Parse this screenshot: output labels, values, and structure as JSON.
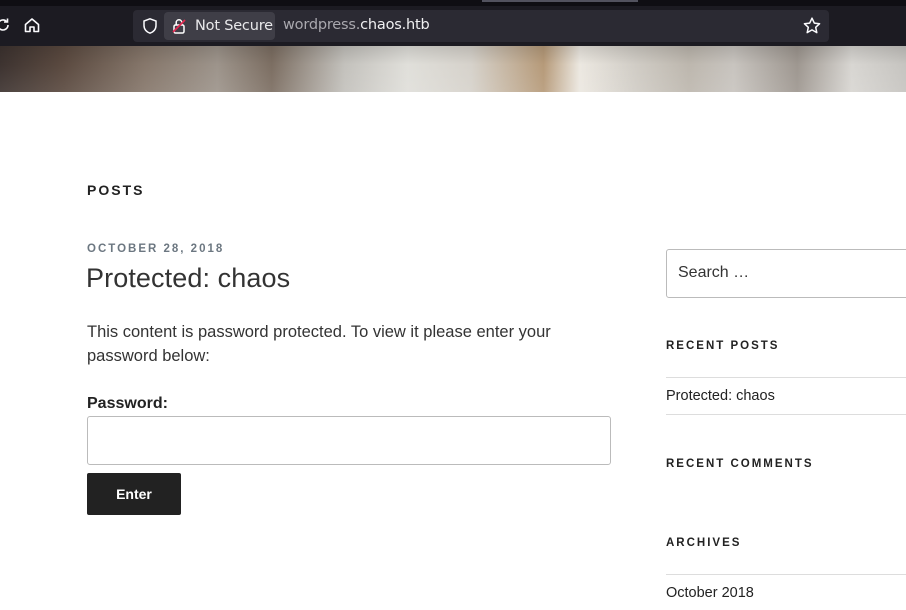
{
  "browser": {
    "security_label": "Not Secure",
    "url_prefix": "wordpress.",
    "url_host": "chaos.htb"
  },
  "page": {
    "section_heading": "POSTS",
    "post": {
      "date": "OCTOBER 28, 2018",
      "title": "Protected: chaos",
      "body": "This content is password protected. To view it please enter your password below:",
      "password_label": "Password:",
      "password_value": "",
      "submit_label": "Enter"
    }
  },
  "sidebar": {
    "search_placeholder": "Search …",
    "recent_posts_title": "RECENT POSTS",
    "recent_posts": [
      "Protected: chaos"
    ],
    "recent_comments_title": "RECENT COMMENTS",
    "archives_title": "ARCHIVES",
    "archives": [
      "October 2018"
    ]
  }
}
